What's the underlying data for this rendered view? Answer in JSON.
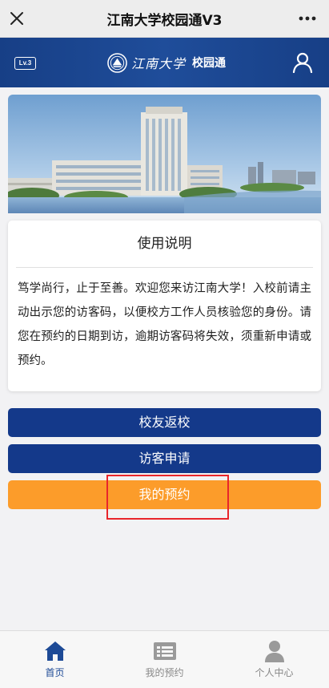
{
  "topbar": {
    "title": "江南大学校园通V3"
  },
  "header": {
    "level_badge": "Lv.3",
    "logo_text": "江南大学",
    "app_name": "校园通"
  },
  "instructions": {
    "title": "使用说明",
    "body": "笃学尚行，止于至善。欢迎您来访江南大学！入校前请主动出示您的访客码，以便校方工作人员核验您的身份。请您在预约的日期到访，逾期访客码将失效，须重新申请或预约。"
  },
  "buttons": {
    "alumni": "校友返校",
    "visitor": "访客申请",
    "my_reservation": "我的预约"
  },
  "tabbar": {
    "items": [
      {
        "label": "首页",
        "icon": "home-icon",
        "active": true
      },
      {
        "label": "我的预约",
        "icon": "list-icon",
        "active": false
      },
      {
        "label": "个人中心",
        "icon": "person-icon",
        "active": false
      }
    ]
  },
  "colors": {
    "primary": "#14398a",
    "accent": "#fc9c2a",
    "highlight": "#e8252b",
    "tab_active": "#1d4a96",
    "tab_inactive": "#888888"
  }
}
